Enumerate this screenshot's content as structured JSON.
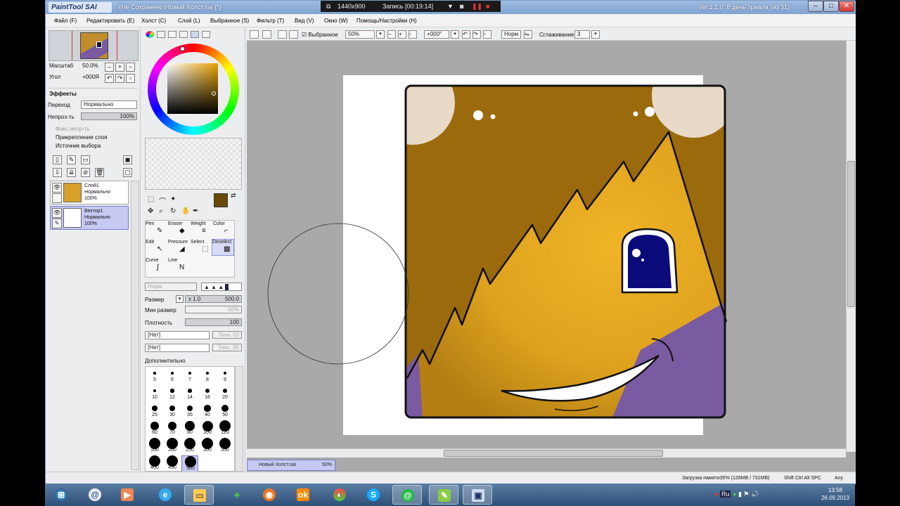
{
  "titlebar": {
    "app_logo": "PaintTool SAI",
    "title": "(Не Сохранено)Новый Холст.sai (*)",
    "trial": "Ver.1.1.0: 8 день триала (из 31)",
    "minimize": "–",
    "restore": "□",
    "close": "✕"
  },
  "recorder": {
    "resolution": "1440x900",
    "record_label": "Запись [00:19:14]"
  },
  "menu": [
    "Файл (F)",
    "Редактировать (E)",
    "Холст (C)",
    "Слой (L)",
    "Выбранное (S)",
    "Фильтр (T)",
    "Вид (V)",
    "Окно (W)",
    "Помощь/Настройки (H)"
  ],
  "navigator": {
    "scale_label": "Масштаб",
    "scale_value": "50.0%",
    "angle_label": "Угол",
    "angle_value": "+000Я"
  },
  "effects": {
    "header": "Эффекты",
    "blend_label": "Переход",
    "blend_value": "Нормально",
    "opacity_label": "Непроз-ть",
    "opacity_value": "100%",
    "protect_opacity": "Фикс.непр-ть",
    "clip_layer": "Прикрепление слоя",
    "selection_source": "Источник выбора"
  },
  "layers": [
    {
      "name": "Слой1",
      "mode": "Нормально",
      "opacity": "100%"
    },
    {
      "name": "Вектор1",
      "mode": "Нормально",
      "opacity": "100%"
    }
  ],
  "colors": {
    "primary": "#6a4a0a",
    "canvas_bg": "#a9a9a9",
    "face": "#e0a520",
    "purple": "#7a5aa0",
    "accent": "#c6c9f2"
  },
  "tools": [
    {
      "label": "Pen"
    },
    {
      "label": "Eraser"
    },
    {
      "label": "Weight"
    },
    {
      "label": "Color"
    },
    {
      "label": "Edit"
    },
    {
      "label": "Pressure"
    },
    {
      "label": "Select"
    },
    {
      "label": "Deselect"
    },
    {
      "label": "Curve"
    },
    {
      "label": "Line"
    }
  ],
  "brush": {
    "mode_placeholder": "Норм",
    "size_label": "Размер",
    "size_mult": "x 1.0",
    "size_value": "500.0",
    "min_size_label": "Мин размер",
    "min_size_value": "50%",
    "density_label": "Плотность",
    "density_value": "100",
    "shape1": "[Нет]",
    "shape2": "[Нет]",
    "shape1_val": "Лень 50",
    "shape2_val": "Текс. 95",
    "advanced": "Дополнительно"
  },
  "brush_sizes": [
    "5",
    "6",
    "7",
    "8",
    "9",
    "10",
    "12",
    "14",
    "16",
    "20",
    "25",
    "30",
    "35",
    "40",
    "50",
    "60",
    "70",
    "80",
    "100",
    "120",
    "160",
    "200",
    "250",
    "300",
    "350",
    "400",
    "450",
    "500"
  ],
  "toolbar": {
    "selected_label": "Выбранное",
    "zoom": "50%",
    "angle": "+000°",
    "norm": "Норм",
    "smoothing_label": "Сглаживание",
    "smoothing_value": "3"
  },
  "doc_tab": {
    "name": "Новый Холст.sai",
    "zoom": "50%"
  },
  "status": {
    "memory": "Загрузка памяти35% (126MB / 731MB)",
    "keys": "Shift Ctrl Alt SPC",
    "any": "Any"
  },
  "taskbar": {
    "time": "13:58",
    "date": "26.09.2013",
    "lang": "Ru"
  }
}
